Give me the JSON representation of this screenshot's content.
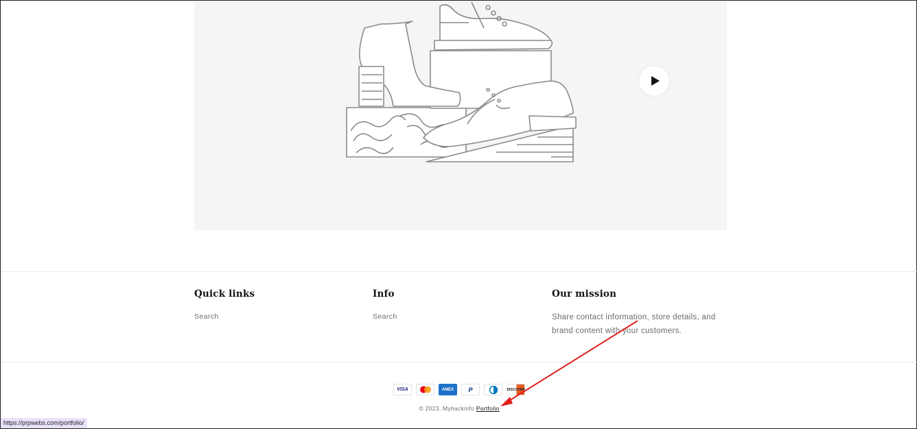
{
  "video": {
    "play_label": "Play video",
    "colors": {
      "background": "#f5f5f5",
      "line": "#8a8a8a"
    }
  },
  "footer": {
    "quick_links": {
      "heading": "Quick links",
      "links": [
        "Search"
      ]
    },
    "info": {
      "heading": "Info",
      "links": [
        "Search"
      ]
    },
    "mission": {
      "heading": "Our mission",
      "text": "Share contact information, store details, and brand content with your customers."
    }
  },
  "payments": [
    {
      "name": "visa-icon",
      "label": "VISA",
      "color": "#1a1f71"
    },
    {
      "name": "mastercard-icon",
      "label": "",
      "color": "#eb001b"
    },
    {
      "name": "amex-icon",
      "label": "AMEX",
      "color": "#1e72c8"
    },
    {
      "name": "paypal-icon",
      "label": "P",
      "color": "#003087"
    },
    {
      "name": "diners-icon",
      "label": "",
      "color": "#0079be"
    },
    {
      "name": "discover-icon",
      "label": "DISCOVER",
      "color": "#e55c20"
    }
  ],
  "copyright": {
    "prefix": "© 2023, Myhackinfo",
    "link": "Portfolio"
  },
  "status_url": "https://prpwebs.com/portfolio/",
  "annotation": {
    "arrow_color": "#e0201e"
  }
}
